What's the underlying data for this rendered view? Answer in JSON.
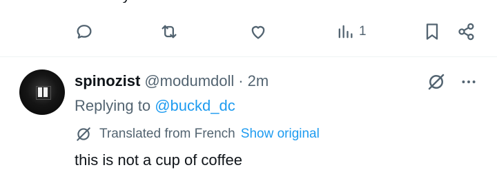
{
  "previous_tweet": {
    "cut_text": "chickory",
    "views_count": "1"
  },
  "icons": {
    "reply": "comment-bubble-icon",
    "retweet": "retweet-icon",
    "like": "heart-icon",
    "views": "bar-chart-icon",
    "bookmark": "bookmark-icon",
    "share": "share-icon",
    "translate": "translate-icon",
    "more": "more-horizontal-icon"
  },
  "tweet": {
    "display_name": "spinozist",
    "handle": "@modumdoll",
    "separator": "·",
    "time": "2m",
    "replying_prefix": "Replying to",
    "replying_to": "@buckd_dc",
    "translated_label": "Translated from French",
    "show_original": "Show original",
    "text": "this is not a cup of coffee"
  },
  "colors": {
    "accent": "#1d9bf0",
    "muted": "#536471",
    "text": "#0f1419"
  }
}
